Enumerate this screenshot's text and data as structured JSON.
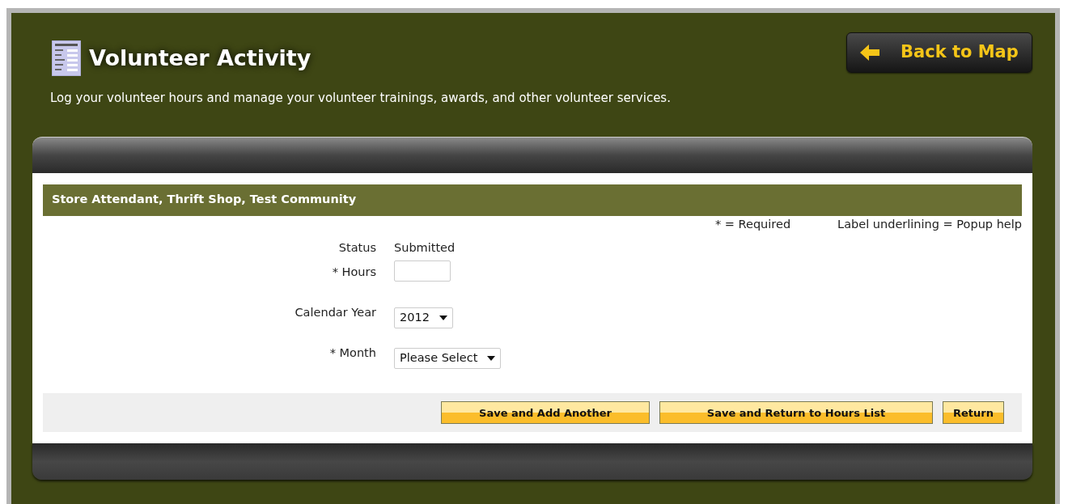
{
  "page": {
    "title": "Volunteer Activity",
    "back_button": "Back to Map",
    "description": "Log your volunteer hours and manage your volunteer trainings, awards, and other volunteer services."
  },
  "form": {
    "heading": "Store Attendant, Thrift Shop, Test Community",
    "legend": [
      "* = Required",
      "Label underlining = Popup help"
    ],
    "fields": [
      {
        "kind": "text",
        "label": "Status",
        "value": "Submitted"
      },
      {
        "kind": "input",
        "label": "* Hours"
      },
      {
        "kind": "select",
        "label": "Calendar Year",
        "value": "2012"
      },
      {
        "kind": "select",
        "label": "* Month",
        "value": "Please Select"
      }
    ],
    "buttons": [
      "Save and Add Another",
      "Save and Return to Hours List",
      "Return"
    ]
  }
}
